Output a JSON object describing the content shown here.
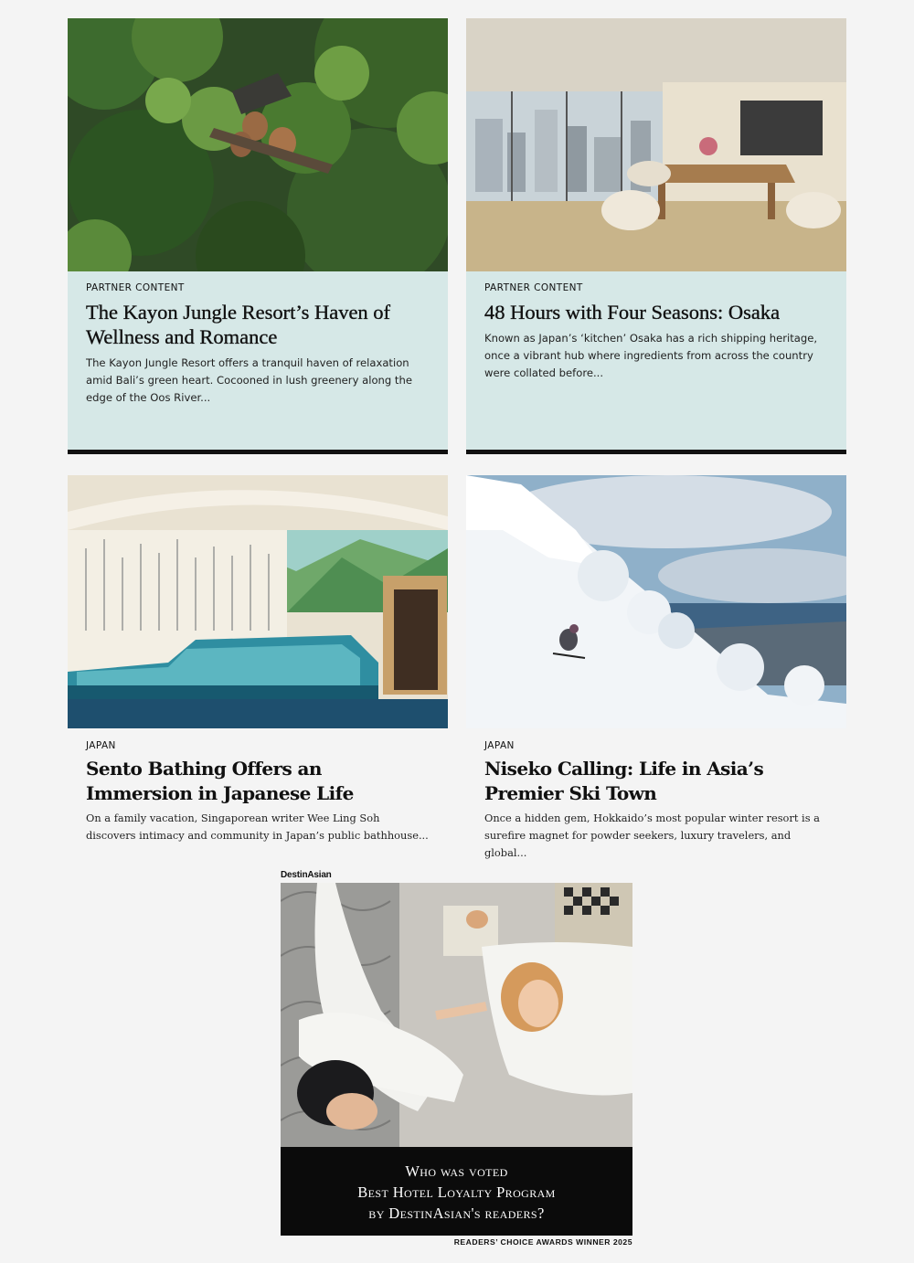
{
  "cards": [
    {
      "kicker": "PARTNER CONTENT",
      "title": "The Kayon Jungle Resort’s Haven of Wellness and Romance",
      "description": "The Kayon Jungle Resort offers a tranquil haven of relaxation amid Bali’s green heart. Cocooned in lush greenery along the edge of the Oos River..."
    },
    {
      "kicker": "PARTNER CONTENT",
      "title": "48 Hours with Four Seasons: Osaka",
      "description": "Known as Japan’s ‘kitchen’ Osaka has a rich shipping heritage, once a vibrant hub where ingredients from across the country were collated before..."
    },
    {
      "kicker": "JAPAN",
      "title": "Sento Bathing Offers an Immersion in Japanese Life",
      "description": "On a family vacation, Singaporean writer Wee Ling Soh discovers intimacy and community in Japan’s public bathhouse..."
    },
    {
      "kicker": "JAPAN",
      "title": "Niseko Calling: Life in Asia’s Premier Ski Town",
      "description": "Once a hidden gem, Hokkaido’s most popular winter resort is a surefire magnet for powder seekers, luxury travelers, and global..."
    }
  ],
  "ad": {
    "brand": "DestinAsian",
    "caption_lines": [
      "Who was voted",
      "Best Hotel Loyalty Program",
      "by DestinAsian's readers?"
    ],
    "footer": "READERS’ CHOICE AWARDS WINNER 2025"
  },
  "colors": {
    "partner_bg": "#d6e8e7",
    "accent_rule": "#111111",
    "page_bg": "#f4f4f4"
  }
}
